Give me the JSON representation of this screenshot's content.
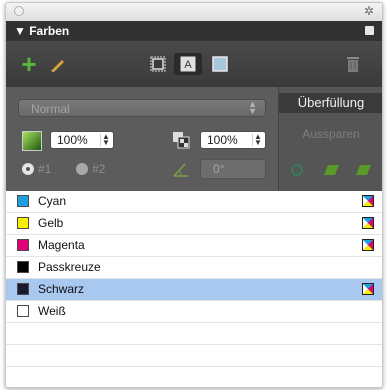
{
  "panel": {
    "title": "▼ Farben",
    "icons": {
      "close": "circle-close-icon",
      "gear": "gear-icon",
      "menu": "panel-menu-icon"
    }
  },
  "toolbar": {
    "new_swatch_icon": "plus-icon",
    "edit_icon": "pencil-icon",
    "stroke_icon": "stroke-swatch-icon",
    "text_label": "A",
    "fill_icon": "fill-swatch-icon",
    "delete_icon": "trash-icon"
  },
  "controls": {
    "blend_mode": "Normal",
    "gradient_icon": "gradient-icon",
    "opacity_value": "100%",
    "tint_icon": "tint-icon",
    "tint_value": "100%",
    "radio1_label": "#1",
    "radio2_label": "#2",
    "angle_icon": "angle-icon",
    "angle_value": "0°",
    "selected_radio": "#1"
  },
  "overprint": {
    "header": "Überfüllung",
    "knockout_label": "Aussparen",
    "icons": [
      "reset-icon",
      "overprint-fill-icon",
      "overprint-stroke-icon"
    ]
  },
  "swatches": [
    {
      "name": "Cyan",
      "color": "#1ea0e0",
      "process_mark": true
    },
    {
      "name": "Gelb",
      "color": "#f8f000",
      "process_mark": true
    },
    {
      "name": "Magenta",
      "color": "#e0007a",
      "process_mark": true
    },
    {
      "name": "Passkreuze",
      "color": "#000000",
      "process_mark": false
    },
    {
      "name": "Schwarz",
      "color": "#1a1a2e",
      "process_mark": true,
      "selected": true
    },
    {
      "name": "Weiß",
      "color": "#ffffff",
      "process_mark": false
    }
  ]
}
